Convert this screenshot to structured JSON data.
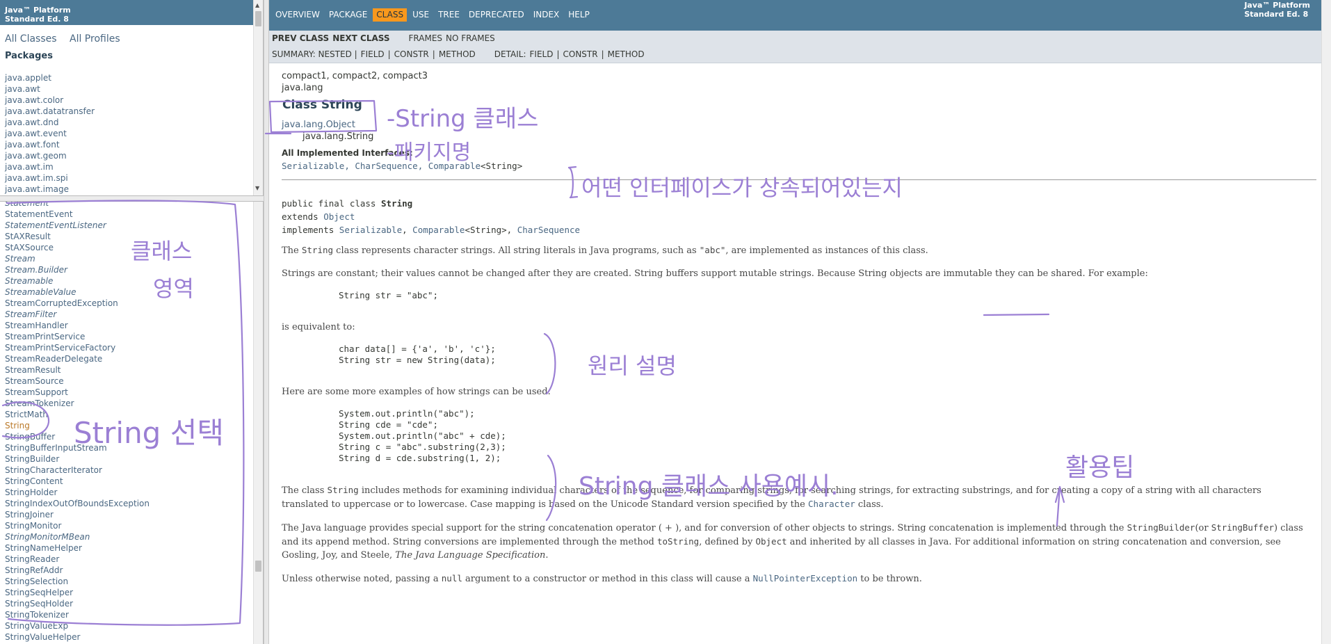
{
  "left_top": {
    "brand_line1": "Java™ Platform",
    "brand_line2": "Standard Ed. 8",
    "all_classes": "All Classes",
    "all_profiles": "All Profiles",
    "packages_heading": "Packages",
    "packages": [
      "java.applet",
      "java.awt",
      "java.awt.color",
      "java.awt.datatransfer",
      "java.awt.dnd",
      "java.awt.event",
      "java.awt.font",
      "java.awt.geom",
      "java.awt.im",
      "java.awt.im.spi",
      "java.awt.image"
    ]
  },
  "left_bottom": {
    "classes": [
      {
        "name": "Statement",
        "italic": true
      },
      {
        "name": "StatementEvent",
        "italic": false
      },
      {
        "name": "StatementEventListener",
        "italic": true
      },
      {
        "name": "StAXResult",
        "italic": false
      },
      {
        "name": "StAXSource",
        "italic": false
      },
      {
        "name": "Stream",
        "italic": true
      },
      {
        "name": "Stream.Builder",
        "italic": true
      },
      {
        "name": "Streamable",
        "italic": true
      },
      {
        "name": "StreamableValue",
        "italic": true
      },
      {
        "name": "StreamCorruptedException",
        "italic": false
      },
      {
        "name": "StreamFilter",
        "italic": true
      },
      {
        "name": "StreamHandler",
        "italic": false
      },
      {
        "name": "StreamPrintService",
        "italic": false
      },
      {
        "name": "StreamPrintServiceFactory",
        "italic": false
      },
      {
        "name": "StreamReaderDelegate",
        "italic": false
      },
      {
        "name": "StreamResult",
        "italic": false
      },
      {
        "name": "StreamSource",
        "italic": false
      },
      {
        "name": "StreamSupport",
        "italic": false
      },
      {
        "name": "StreamTokenizer",
        "italic": false
      },
      {
        "name": "StrictMath",
        "italic": false
      },
      {
        "name": "String",
        "italic": false,
        "selected": true
      },
      {
        "name": "StringBuffer",
        "italic": false
      },
      {
        "name": "StringBufferInputStream",
        "italic": false
      },
      {
        "name": "StringBuilder",
        "italic": false
      },
      {
        "name": "StringCharacterIterator",
        "italic": false
      },
      {
        "name": "StringContent",
        "italic": false
      },
      {
        "name": "StringHolder",
        "italic": false
      },
      {
        "name": "StringIndexOutOfBoundsException",
        "italic": false
      },
      {
        "name": "StringJoiner",
        "italic": false
      },
      {
        "name": "StringMonitor",
        "italic": false
      },
      {
        "name": "StringMonitorMBean",
        "italic": true
      },
      {
        "name": "StringNameHelper",
        "italic": false
      },
      {
        "name": "StringReader",
        "italic": false
      },
      {
        "name": "StringRefAddr",
        "italic": false
      },
      {
        "name": "StringSelection",
        "italic": false
      },
      {
        "name": "StringSeqHelper",
        "italic": false
      },
      {
        "name": "StringSeqHolder",
        "italic": false
      },
      {
        "name": "StringTokenizer",
        "italic": false
      },
      {
        "name": "StringValueExp",
        "italic": false
      },
      {
        "name": "StringValueHelper",
        "italic": false
      }
    ]
  },
  "topnav": {
    "items": [
      "Overview",
      "Package",
      "Class",
      "Use",
      "Tree",
      "Deprecated",
      "Index",
      "Help"
    ],
    "active": "Class",
    "brand_line1": "Java™ Platform",
    "brand_line2": "Standard Ed. 8"
  },
  "subnav": {
    "prev_class": "PREV CLASS",
    "next_class": "NEXT CLASS",
    "frames": "FRAMES",
    "no_frames": "NO FRAMES",
    "summary_label": "SUMMARY: NESTED |",
    "summary_field": "FIELD",
    "summary_sep1": "|",
    "summary_constr": "CONSTR",
    "summary_sep2": "|",
    "summary_method": "METHOD",
    "detail_label": "DETAIL:",
    "detail_field": "FIELD",
    "detail_sep1": "|",
    "detail_constr": "CONSTR",
    "detail_sep2": "|",
    "detail_method": "METHOD"
  },
  "content": {
    "profiles": "compact1, compact2, compact3",
    "package": "java.lang",
    "class_title": "Class String",
    "tree_parent": "java.lang.Object",
    "tree_child": "java.lang.String",
    "impl_label": "All Implemented Interfaces:",
    "impl_serializable": "Serializable",
    "impl_sep1": ", ",
    "impl_charseq": "CharSequence",
    "impl_sep2": ", ",
    "impl_comparable": "Comparable",
    "impl_comparable_arg": "<String>",
    "decl_line1_prefix": "public final class ",
    "decl_line1_name": "String",
    "decl_line2_prefix": "extends ",
    "decl_line2_object": "Object",
    "decl_line3_prefix": "implements ",
    "decl_line3_serializable": "Serializable",
    "decl_line3_sep1": ", ",
    "decl_line3_comparable": "Comparable",
    "decl_line3_arg": "<String>",
    "decl_line3_sep2": ", ",
    "decl_line3_charseq": "CharSequence",
    "p1_a": "The ",
    "p1_code": "String",
    "p1_b": " class represents character strings. All string literals in Java programs, such as ",
    "p1_code2": "\"abc\"",
    "p1_c": ", are implemented as instances of this class.",
    "p2": "Strings are constant; their values cannot be changed after they are created. String buffers support mutable strings. Because String objects are immutable they can be shared. For example:",
    "code1": "String str = \"abc\";",
    "p3": "is equivalent to:",
    "code2": "char data[] = {'a', 'b', 'c'};\nString str = new String(data);",
    "p4": "Here are some more examples of how strings can be used:",
    "code3": "System.out.println(\"abc\");\nString cde = \"cde\";\nSystem.out.println(\"abc\" + cde);\nString c = \"abc\".substring(2,3);\nString d = cde.substring(1, 2);",
    "p5_a": "The class ",
    "p5_code": "String",
    "p5_b": " includes methods for examining individual characters of the sequence, for comparing strings, for searching strings, for extracting substrings, and for creating a copy of a string with all characters translated to uppercase or to lowercase. Case mapping is based on the Unicode Standard version specified by the ",
    "p5_link": "Character",
    "p5_c": " class.",
    "p6_a": "The Java language provides special support for the string concatenation operator ( + ), and for conversion of other objects to strings. String concatenation is implemented through the ",
    "p6_code1": "StringBuilder",
    "p6_b": "(or ",
    "p6_code2": "StringBuffer",
    "p6_c": ") class and its append method. String conversions are implemented through the method ",
    "p6_code3": "toString",
    "p6_d": ", defined by ",
    "p6_code4": "Object",
    "p6_e": " and inherited by all classes in Java. For additional information on string concatenation and conversion, see Gosling, Joy, and Steele, ",
    "p6_em": "The Java Language Specification",
    "p6_f": ".",
    "p7_a": "Unless otherwise noted, passing a ",
    "p7_code": "null",
    "p7_b": " argument to a constructor or method in this class will cause a ",
    "p7_link": "NullPointerException",
    "p7_c": " to be thrown."
  },
  "annotations": {
    "string_class": "-String 클래스",
    "package_name": "-패키지명",
    "interfaces": "어떤 인터페이스가 상속되어있는지",
    "class_area_1": "클래스",
    "class_area_2": "영역",
    "string_select": "String 선택",
    "principle": "원리 설명",
    "usage": "String 클래스 사용예시.",
    "tip": "활용팁",
    "color": "#9b7fd4"
  }
}
